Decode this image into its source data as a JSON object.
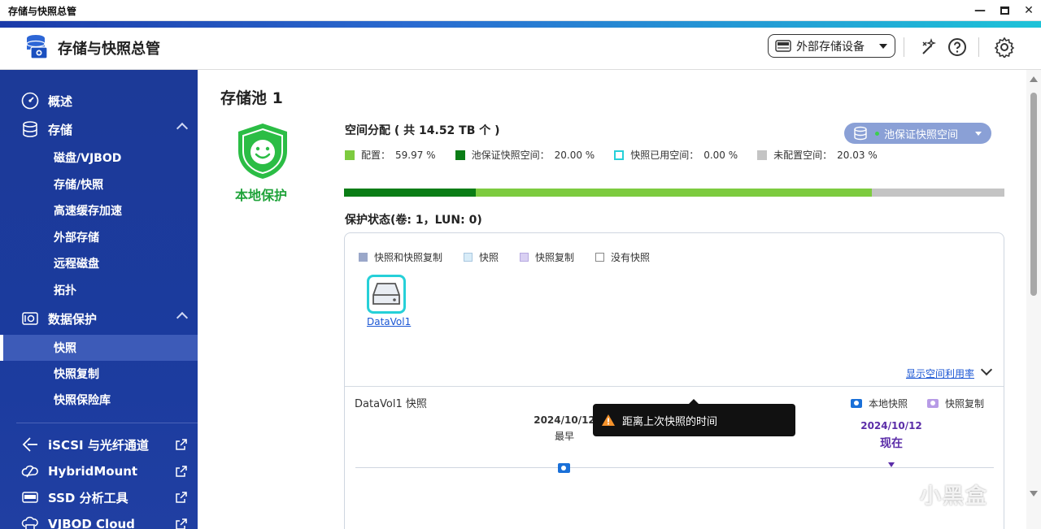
{
  "window": {
    "title": "存储与快照总管"
  },
  "header": {
    "app_title": "存储与快照总管",
    "ext_storage_label": "外部存储设备"
  },
  "sidebar": {
    "overview": "概述",
    "storage": "存储",
    "storage_items": [
      "磁盘/VJBOD",
      "存储/快照",
      "高速缓存加速",
      "外部存储",
      "远程磁盘",
      "拓扑"
    ],
    "data_protection": "数据保护",
    "protection_items": [
      "快照",
      "快照复制",
      "快照保险库"
    ],
    "active_item": "快照",
    "apps": [
      "iSCSI 与光纤通道",
      "HybridMount",
      "SSD 分析工具",
      "VJBOD Cloud"
    ]
  },
  "main": {
    "pool_title": "存储池 1",
    "local_protection": "本地保护",
    "alloc_title": "空间分配 ( 共 14.52 TB 个 )",
    "pool_snapshot_button": "池保证快照空间",
    "legend": [
      {
        "label": "配置：",
        "value": "59.97 %",
        "color": "#7dcb3f"
      },
      {
        "label": "池保证快照空间：",
        "value": "20.00 %",
        "color": "#0a7d16"
      },
      {
        "label": "快照已用空间：",
        "value": "0.00 %",
        "color": "#26d0d8"
      },
      {
        "label": "未配置空间：",
        "value": "20.03 %",
        "color": "#c4c4c4"
      }
    ],
    "usage_fractions": {
      "guaranteed": 0.2,
      "configured": 0.5997,
      "snapshot_used": 0.0,
      "unconfigured": 0.2003
    },
    "protection_status_title": "保护状态(卷: 1，LUN: 0)",
    "protection_legend": [
      {
        "label": "快照和快照复制",
        "color": "#9aa7c9"
      },
      {
        "label": "快照",
        "color": "#d8ecf8"
      },
      {
        "label": "快照复制",
        "color": "#d9d0f3"
      },
      {
        "label": "没有快照",
        "color": "#ffffff"
      }
    ],
    "volume_name": "DataVol1",
    "show_usage_link": "显示空间利用率",
    "snapshot_title": "DataVol1 快照",
    "snapshot_legend": {
      "local": "本地快照",
      "replication": "快照复制"
    },
    "timeline": {
      "earliest_date": "2024/10/12",
      "earliest_label": "最早",
      "now_date": "2024/10/12",
      "now_label": "现在"
    },
    "tooltip": "距离上次快照的时间"
  },
  "watermark": "小黑盒"
}
